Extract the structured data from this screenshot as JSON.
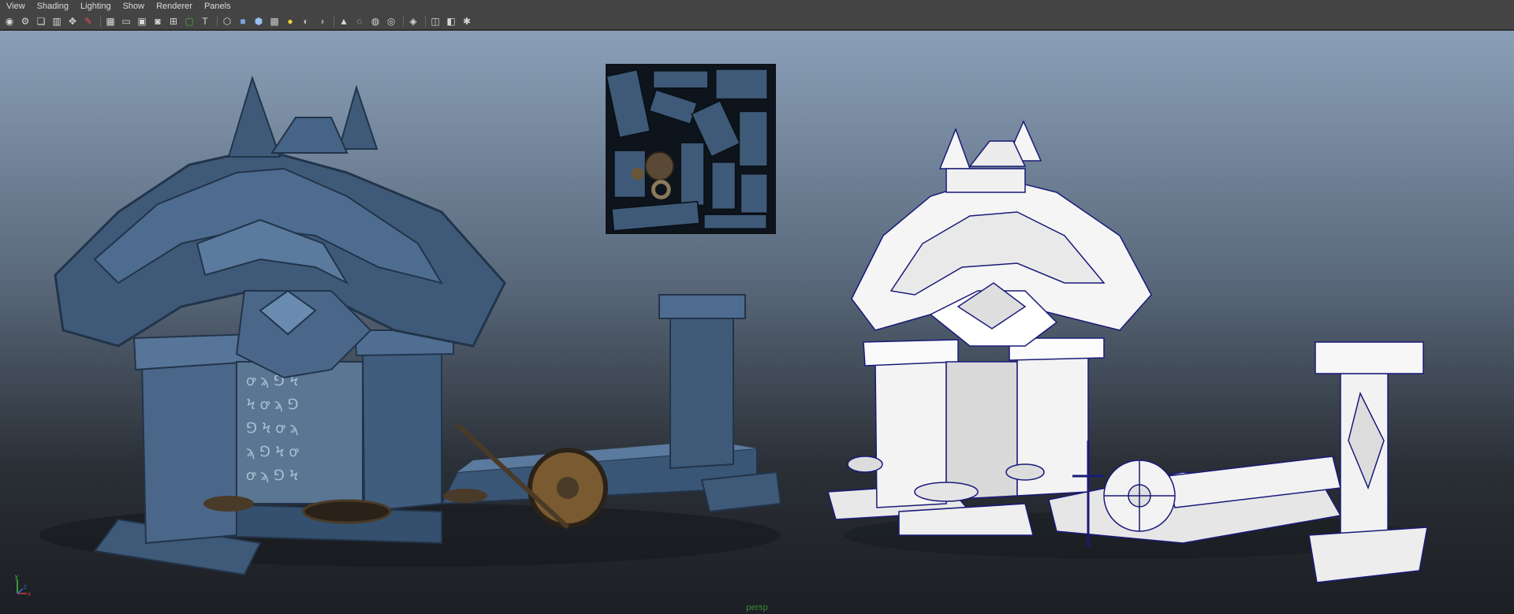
{
  "menus": [
    "View",
    "Shading",
    "Lighting",
    "Show",
    "Renderer",
    "Panels"
  ],
  "toolbar": {
    "icons": [
      "select-camera-icon",
      "camera-attributes-icon",
      "bookmarks-icon",
      "image-plane-icon",
      "2d-pan-zoom-icon",
      "grease-pencil-icon",
      "separator",
      "grid-icon",
      "film-gate-icon",
      "resolution-gate-icon",
      "gate-mask-icon",
      "field-chart-icon",
      "safe-action-icon",
      "safe-title-icon",
      "separator",
      "wireframe-icon",
      "smooth-shade-icon",
      "default-material-icon",
      "textured-icon",
      "use-all-lights-icon",
      "shadows-icon",
      "screen-space-ao-icon",
      "separator",
      "isolate-select-icon",
      "xray-icon",
      "xray-joints-icon",
      "xray-components-icon",
      "separator",
      "ui-shading-icon",
      "separator",
      "viewport-layout-icon",
      "two-panel-icon",
      "node-editor-icon"
    ]
  },
  "viewport": {
    "camera_label": "persp",
    "axis": {
      "y": "y",
      "x": "x",
      "z": "z"
    },
    "background_top": "#8a9fb7",
    "background_bottom": "#1c1f23"
  },
  "colors": {
    "stone": "#3f5a78",
    "stone_dark": "#2a3d55",
    "stone_light": "#5a7a9e",
    "white_model": "#f2f2f2",
    "wire": "#1a1a7a",
    "wood": "#7a5a30",
    "bronze": "#4a3a28"
  }
}
